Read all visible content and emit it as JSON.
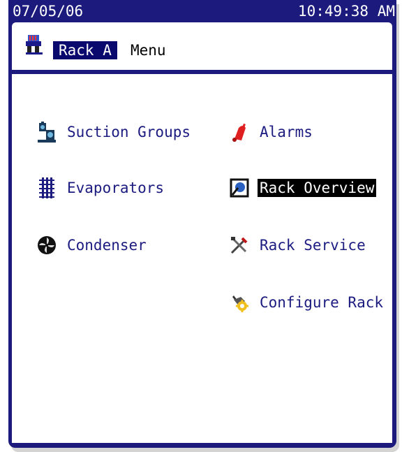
{
  "status": {
    "date": "07/05/06",
    "time": "10:49:38 AM"
  },
  "title": {
    "highlight": "Rack A",
    "rest": "Menu",
    "icon": "rack-icon"
  },
  "menu": {
    "left": [
      {
        "label": "Suction Groups",
        "icon": "compressor-icon"
      },
      {
        "label": "Evaporators",
        "icon": "evaporator-coil-icon"
      },
      {
        "label": "Condenser",
        "icon": "fan-icon"
      }
    ],
    "right": [
      {
        "label": "Alarms",
        "icon": "alarm-bell-icon"
      },
      {
        "label": "Rack Overview",
        "icon": "overview-icon",
        "selected": true
      },
      {
        "label": "Rack Service",
        "icon": "tools-icon"
      },
      {
        "label": "Configure Rack",
        "icon": "gear-hand-icon"
      }
    ]
  },
  "colors": {
    "frame": "#1c1a7c",
    "text": "#1b1b80",
    "selection": "#000000"
  }
}
